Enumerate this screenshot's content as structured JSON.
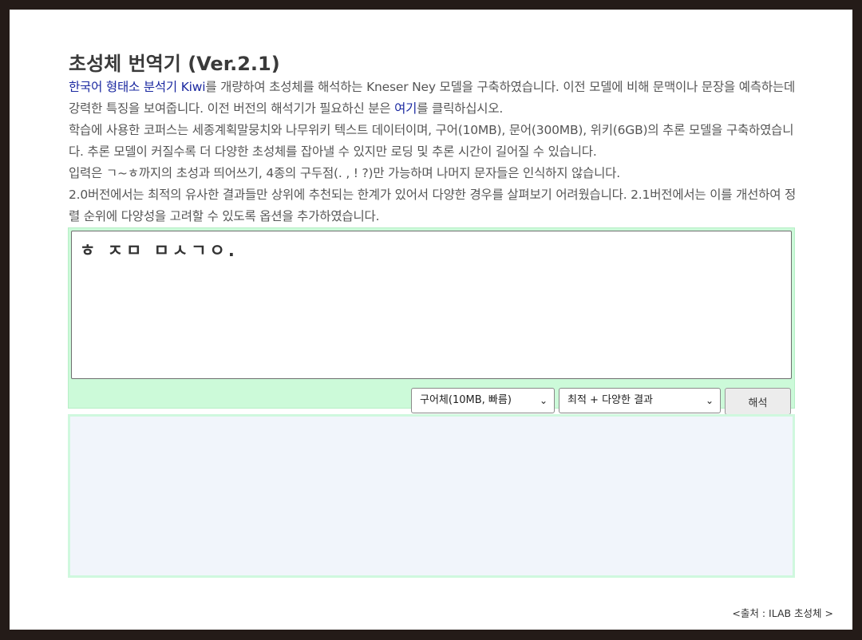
{
  "page": {
    "title": "초성체 번역기 (Ver.2.1)"
  },
  "description": {
    "line1_link": "한국어 형태소 분석기 Kiwi",
    "line1_rest": "를 개량하여 초성체를 해석하는 Kneser Ney 모델을 구축하였습니다. 이전 모델에 비해 문맥이나 문장을 예측하는데 강력한 특징을 보여줍니다. 이전 버전의 해석기가 필요하신 분은 ",
    "line1_here_link": "여기",
    "line1_end": "를 클릭하십시오.",
    "para2": "학습에 사용한 코퍼스는 세종계획말뭉치와 나무위키 텍스트 데이터이며, 구어(10MB), 문어(300MB), 위키(6GB)의 추론 모델을 구축하였습니다. 추론 모델이 커질수록 더 다양한 초성체를 잡아낼 수 있지만 로딩 및 추론 시간이 길어질 수 있습니다.",
    "para3": "입력은 ㄱ~ㅎ까지의 초성과 띄어쓰기, 4종의 구두점(. , ! ?)만 가능하며 나머지 문자들은 인식하지 않습니다.",
    "para4": "2.0버전에서는 최적의 유사한 결과들만 상위에 추천되는 한계가 있어서 다양한 경우를 살펴보기 어려웠습니다. 2.1버전에서는 이를 개선하여 정렬 순위에 다양성을 고려할 수 있도록 옵션을 추가하였습니다."
  },
  "input": {
    "value": "ㅎ ㅈㅁ ㅁㅅㄱㅇ."
  },
  "controls": {
    "model_select": "구어체(10MB, 빠름)",
    "mode_select": "최적 + 다양한 결과",
    "translate_label": "해석",
    "chevron": "⌄"
  },
  "output": {
    "result": ""
  },
  "footer": {
    "source": "<출처 : ILAB 초성체 >"
  },
  "colors": {
    "input_panel_bg": "#ccfad9",
    "output_panel_bg": "#f1f5fb",
    "link": "#1a28a0",
    "frame": "#241b18"
  }
}
